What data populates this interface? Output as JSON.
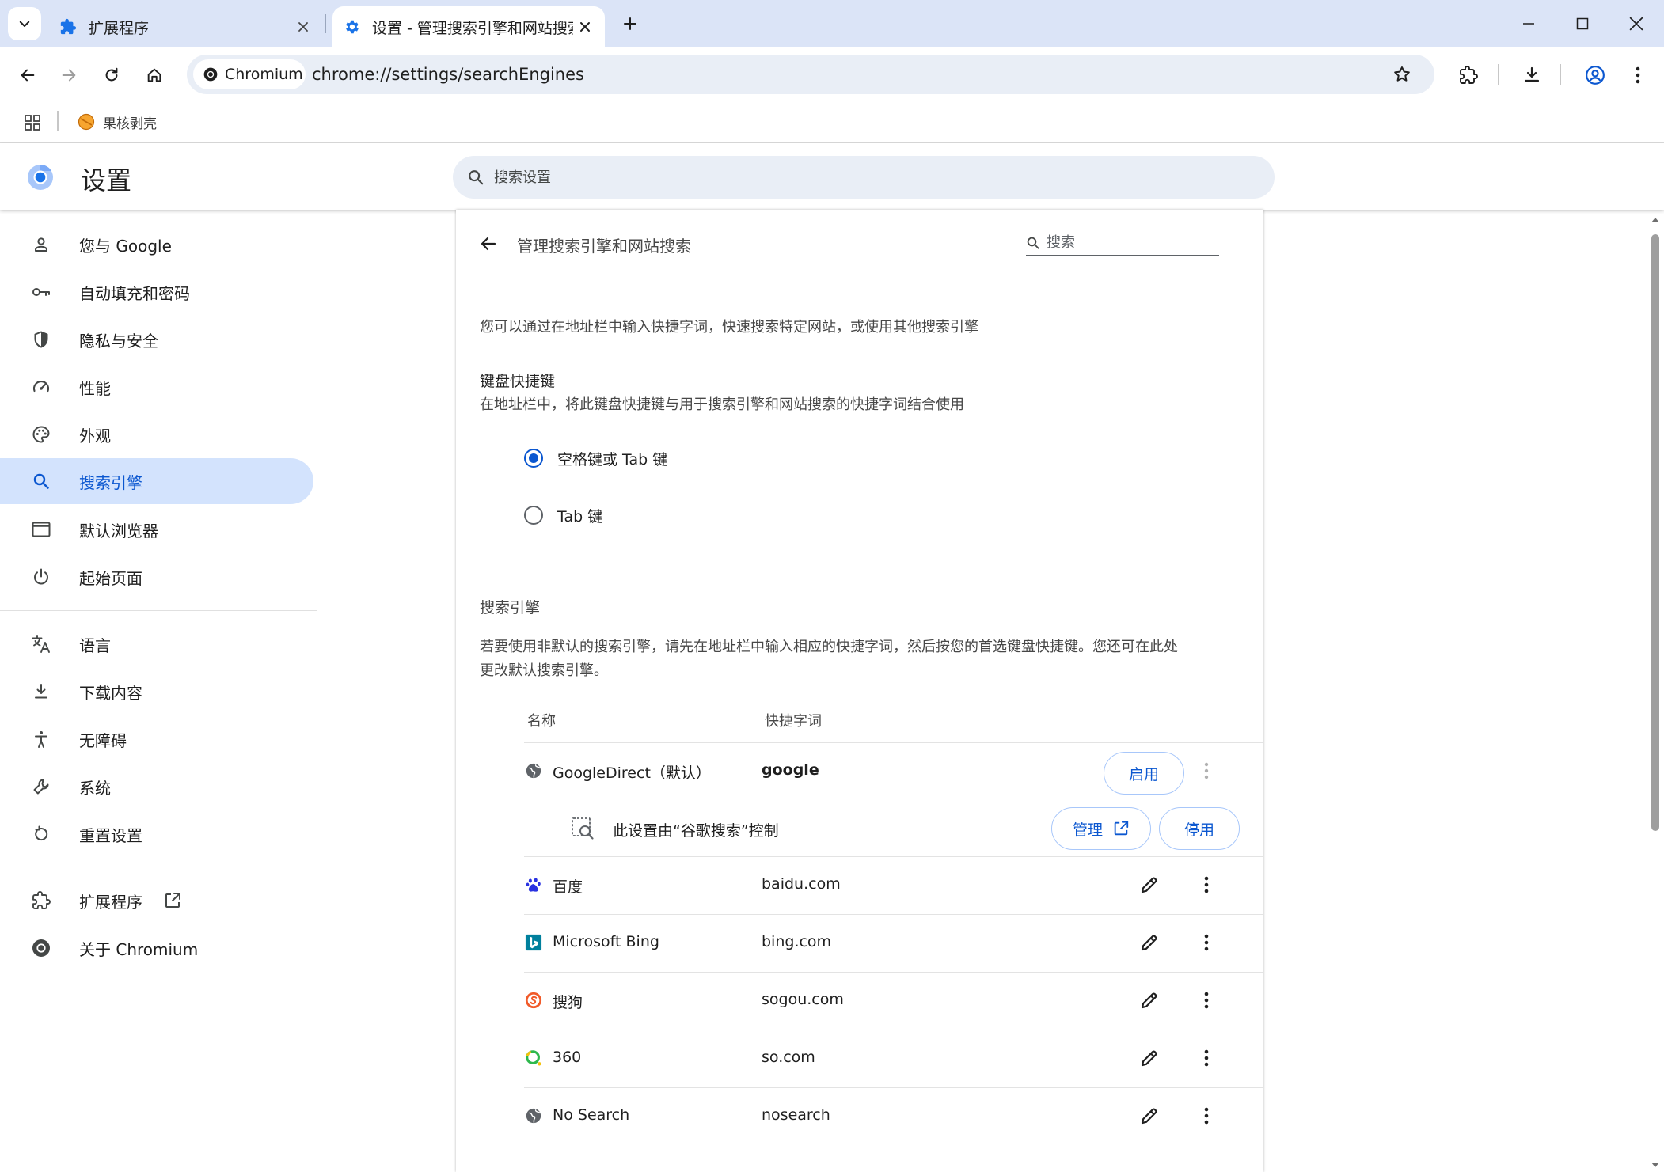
{
  "tabs": [
    {
      "title": "扩展程序",
      "active": false
    },
    {
      "title": "设置 - 管理搜索引擎和网站搜索",
      "active": true
    }
  ],
  "toolbar": {
    "site_chip": "Chromium",
    "url": "chrome://settings/searchEngines"
  },
  "bookmarks": [
    {
      "label": "果核剥壳"
    }
  ],
  "settings": {
    "title": "设置",
    "search_placeholder": "搜索设置"
  },
  "sidebar": {
    "items": [
      {
        "label": "您与 Google",
        "icon": "person-icon"
      },
      {
        "label": "自动填充和密码",
        "icon": "key-icon"
      },
      {
        "label": "隐私与安全",
        "icon": "shield-icon"
      },
      {
        "label": "性能",
        "icon": "speedometer-icon"
      },
      {
        "label": "外观",
        "icon": "palette-icon"
      },
      {
        "label": "搜索引擎",
        "icon": "search-icon",
        "selected": true
      },
      {
        "label": "默认浏览器",
        "icon": "browser-window-icon"
      },
      {
        "label": "起始页面",
        "icon": "power-icon"
      },
      {
        "label": "语言",
        "icon": "translate-icon"
      },
      {
        "label": "下载内容",
        "icon": "download-icon"
      },
      {
        "label": "无障碍",
        "icon": "accessibility-icon"
      },
      {
        "label": "系统",
        "icon": "wrench-icon"
      },
      {
        "label": "重置设置",
        "icon": "reset-icon"
      },
      {
        "label": "扩展程序",
        "icon": "puzzle-icon"
      },
      {
        "label": "关于 Chromium",
        "icon": "chromium-icon"
      }
    ]
  },
  "page": {
    "title": "管理搜索引擎和网站搜索",
    "search_placeholder": "搜索",
    "intro": "您可以通过在地址栏中输入快捷字词，快速搜索特定网站，或使用其他搜索引擎",
    "keyboard": {
      "heading": "键盘快捷键",
      "description": "在地址栏中，将此键盘快捷键与用于搜索引擎和网站搜索的快捷字词结合使用",
      "options": [
        {
          "label": "空格键或 Tab 键",
          "checked": true
        },
        {
          "label": "Tab 键",
          "checked": false
        }
      ]
    },
    "engines": {
      "heading": "搜索引擎",
      "description_line1": "若要使用非默认的搜索引擎，请先在地址栏中输入相应的快捷字词，然后按您的首选键盘快捷键。您还可在此处",
      "description_line2": "更改默认搜索引擎。",
      "col_name": "名称",
      "col_keyword": "快捷字词",
      "default_engine": {
        "name": "GoogleDirect（默认）",
        "keyword": "google",
        "enable_label": "启用",
        "policy_text": "此设置由“谷歌搜索”控制",
        "manage_label": "管理",
        "disable_label": "停用"
      },
      "rows": [
        {
          "name": "百度",
          "keyword": "baidu.com",
          "icon": "baidu-paw-icon"
        },
        {
          "name": "Microsoft Bing",
          "keyword": "bing.com",
          "icon": "bing-logo-icon"
        },
        {
          "name": "搜狗",
          "keyword": "sogou.com",
          "icon": "sogou-logo-icon"
        },
        {
          "name": "360",
          "keyword": "so.com",
          "icon": "360-logo-icon"
        },
        {
          "name": "No Search",
          "keyword": "nosearch",
          "icon": "globe-icon"
        }
      ]
    }
  },
  "colors": {
    "accent": "#0b57d0",
    "selected_bg": "#d3e3fd",
    "tabstrip_bg": "#dbe4f7",
    "field_bg": "#e9eef6"
  }
}
